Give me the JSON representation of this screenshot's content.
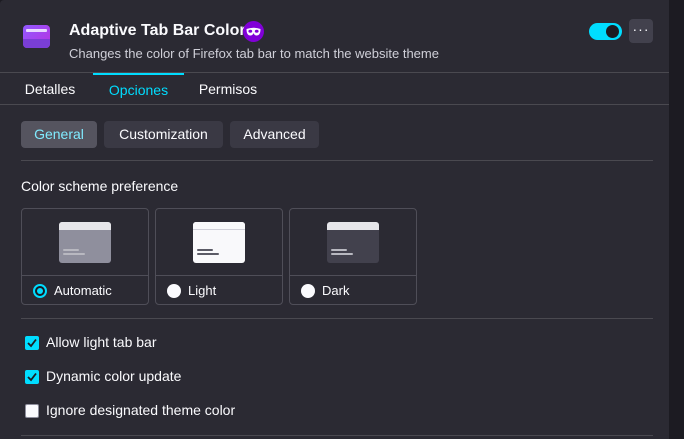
{
  "extension": {
    "title": "Adaptive Tab Bar Color",
    "description": "Changes the color of Firefox tab bar to match the website theme",
    "badge_icon": "private-browsing-mask-icon",
    "enabled": true,
    "more_label": "···"
  },
  "tabs": [
    {
      "label": "Detalles",
      "active": false
    },
    {
      "label": "Opciones",
      "active": true
    },
    {
      "label": "Permisos",
      "active": false
    }
  ],
  "subtabs": [
    {
      "label": "General",
      "active": true
    },
    {
      "label": "Customization",
      "active": false
    },
    {
      "label": "Advanced",
      "active": false
    }
  ],
  "color_scheme": {
    "label": "Color scheme preference",
    "options": [
      {
        "label": "Automatic",
        "selected": true
      },
      {
        "label": "Light",
        "selected": false
      },
      {
        "label": "Dark",
        "selected": false
      }
    ]
  },
  "checkboxes": [
    {
      "label": "Allow light tab bar",
      "checked": true
    },
    {
      "label": "Dynamic color update",
      "checked": true
    },
    {
      "label": "Ignore designated theme color",
      "checked": false
    }
  ],
  "colors": {
    "accent": "#00ddff",
    "background": "#2b2a33",
    "badge": "#8000d7"
  }
}
